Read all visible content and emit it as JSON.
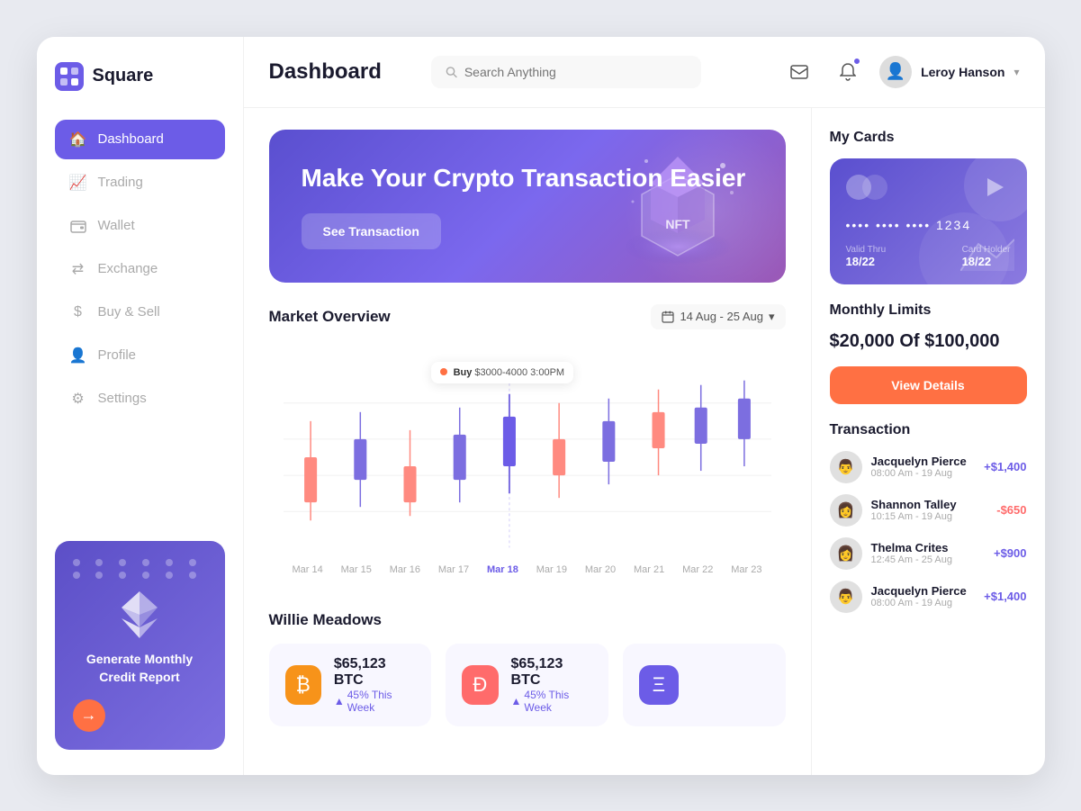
{
  "app": {
    "name": "Square",
    "logo_icon": "⊞"
  },
  "sidebar": {
    "nav_items": [
      {
        "id": "dashboard",
        "label": "Dashboard",
        "icon": "🏠",
        "active": true
      },
      {
        "id": "trading",
        "label": "Trading",
        "icon": "📈",
        "active": false
      },
      {
        "id": "wallet",
        "label": "Wallet",
        "icon": "💳",
        "active": false
      },
      {
        "id": "exchange",
        "label": "Exchange",
        "icon": "🔄",
        "active": false
      },
      {
        "id": "buy-sell",
        "label": "Buy & Sell",
        "icon": "💲",
        "active": false
      },
      {
        "id": "profile",
        "label": "Profile",
        "icon": "👤",
        "active": false
      },
      {
        "id": "settings",
        "label": "Settings",
        "icon": "⚙️",
        "active": false
      }
    ],
    "promo": {
      "title": "Generate Monthly Credit Report",
      "btn_icon": "→"
    }
  },
  "header": {
    "title": "Dashboard",
    "search_placeholder": "Search Anything",
    "user_name": "Leroy Hanson"
  },
  "hero": {
    "title": "Make Your Crypto Transaction Easier",
    "button_label": "See Transaction"
  },
  "market_overview": {
    "title": "Market Overview",
    "date_range": "14 Aug - 25 Aug"
  },
  "chart": {
    "labels": [
      "Mar 14",
      "Mar 15",
      "Mar 16",
      "Mar 17",
      "Mar 18",
      "Mar 19",
      "Mar 20",
      "Mar 21",
      "Mar 22",
      "Mar 23"
    ],
    "tooltip": {
      "label": "Buy",
      "value": "$3000-4000",
      "time": "3:00PM"
    }
  },
  "willie_meadows": {
    "title": "Willie Meadows",
    "cards": [
      {
        "id": "btc",
        "symbol": "BTC",
        "icon": "₿",
        "amount": "$65,123 BTC",
        "change": "45% This Week",
        "color": "btc"
      },
      {
        "id": "dash",
        "symbol": "DASH",
        "icon": "Ð",
        "amount": "$65,123 BTC",
        "change": "45% This Week",
        "color": "dash"
      },
      {
        "id": "eth",
        "symbol": "ETH",
        "icon": "Ξ",
        "amount": "",
        "change": "",
        "color": "eth"
      }
    ]
  },
  "my_cards": {
    "title": "My Cards",
    "card": {
      "number": "•••• •••• •••• 1234",
      "valid_thru_label": "Valid Thru",
      "valid_thru_value": "18/22",
      "card_holder_label": "Card Holder",
      "card_holder_value": "18/22"
    }
  },
  "monthly_limits": {
    "title": "Monthly Limits",
    "current": "$20,000",
    "total": "$100,000",
    "display": "$20,000 Of $100,000",
    "button_label": "View Details"
  },
  "transactions": {
    "title": "Transaction",
    "items": [
      {
        "name": "Jacquelyn Pierce",
        "time": "08:00 Am - 19 Aug",
        "amount": "+$1,400",
        "positive": true,
        "avatar": "👨"
      },
      {
        "name": "Shannon Talley",
        "time": "10:15 Am - 19 Aug",
        "amount": "-$650",
        "positive": false,
        "avatar": "👩"
      },
      {
        "name": "Thelma Crites",
        "time": "12:45 Am - 25 Aug",
        "amount": "+$900",
        "positive": true,
        "avatar": "👩"
      },
      {
        "name": "Jacquelyn Pierce",
        "time": "08:00 Am - 19 Aug",
        "amount": "+$1,400",
        "positive": true,
        "avatar": "👨"
      }
    ]
  }
}
